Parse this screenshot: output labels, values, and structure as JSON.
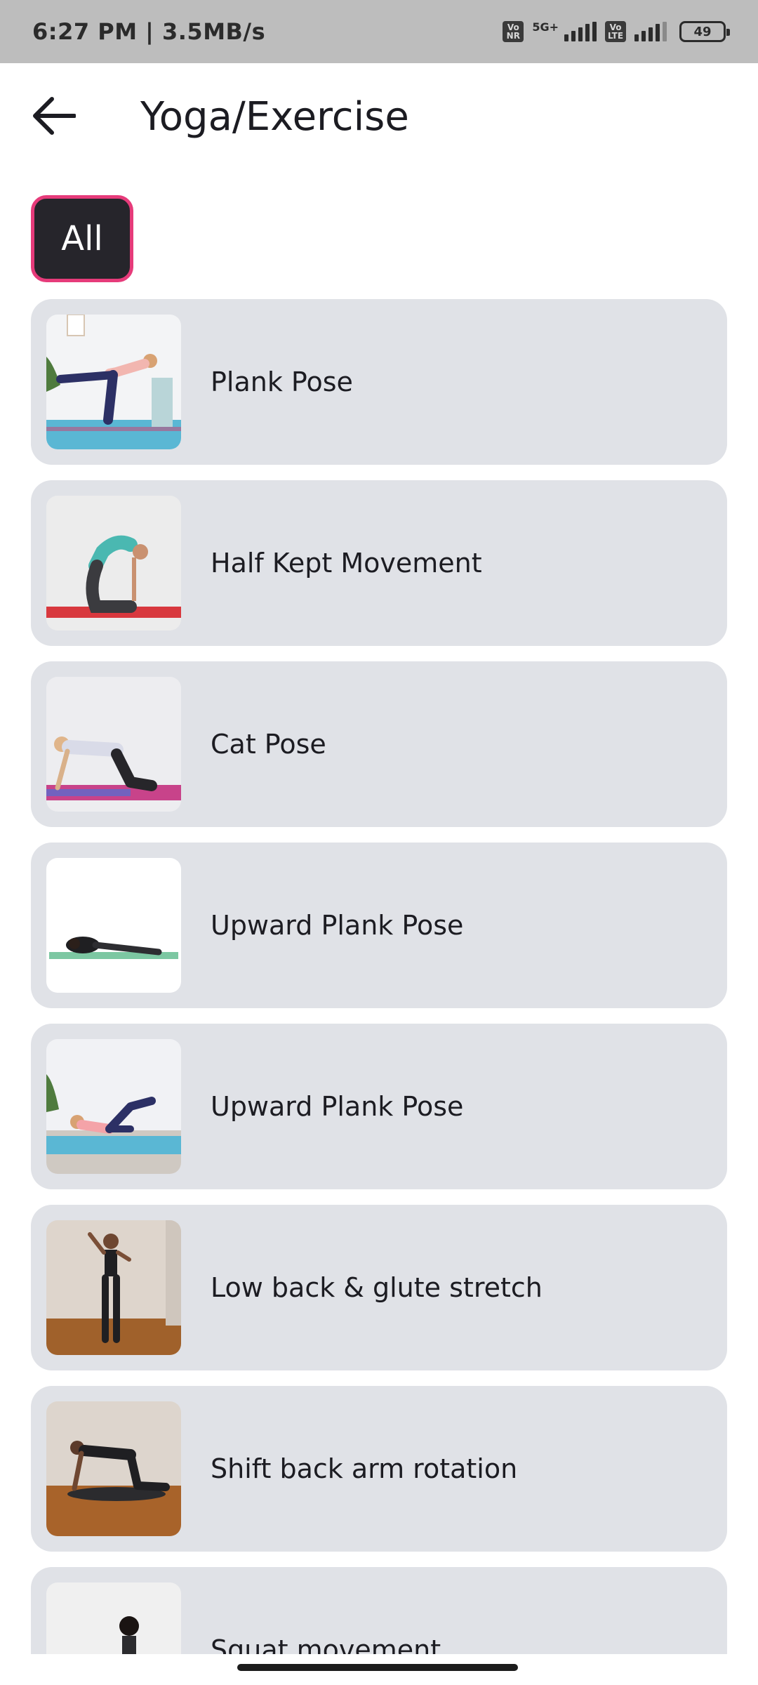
{
  "status_bar": {
    "time_speed": "6:27 PM | 3.5MB/s",
    "sim1_tag": "Vo NR",
    "network_type": "5G+",
    "sim2_tag": "Vo LTE",
    "battery": "49"
  },
  "header": {
    "title": "Yoga/Exercise"
  },
  "filter": {
    "chip_label": "All",
    "chip_border_color": "#e63b7a",
    "chip_background": "#26252b"
  },
  "exercises": [
    {
      "label": "Plank Pose"
    },
    {
      "label": "Half Kept Movement"
    },
    {
      "label": "Cat Pose"
    },
    {
      "label": "Upward Plank Pose"
    },
    {
      "label": "Upward Plank Pose"
    },
    {
      "label": "Low back & glute stretch"
    },
    {
      "label": "Shift back arm rotation"
    },
    {
      "label": "Squat movement"
    }
  ],
  "colors": {
    "card_background": "#e0e2e7",
    "status_bar": "#bdbdbd",
    "text": "#1c1c22"
  }
}
